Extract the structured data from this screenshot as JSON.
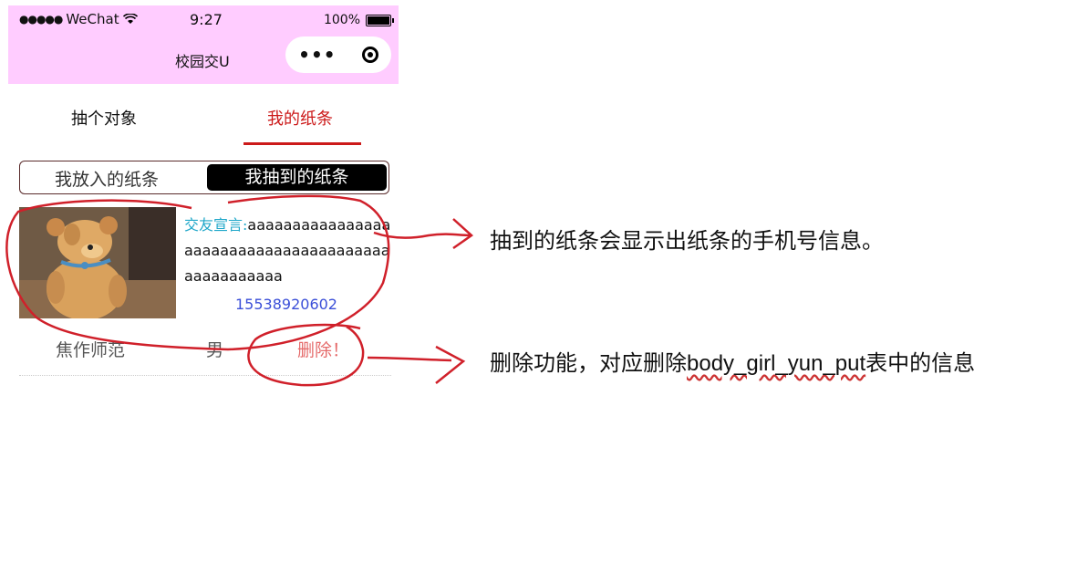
{
  "status_bar": {
    "carrier": "WeChat",
    "time": "9:27",
    "battery": "100%"
  },
  "nav": {
    "title": "校园交U",
    "more_icon": "more-dots-icon",
    "close_icon": "target-circle-icon"
  },
  "tabs": [
    {
      "label": "抽个对象"
    },
    {
      "label": "我的纸条"
    }
  ],
  "segment": {
    "option_a": "我放入的纸条",
    "option_b": "我抽到的纸条"
  },
  "card": {
    "declaration_label": "交友宣言:",
    "declaration_text": "aaaaaaaaaaaaaaaaaaaaaaaaaaaaaaaaaaaaaaaaaaaaaaaaaa",
    "phone": "15538920602",
    "location": "焦作师范",
    "gender": "男",
    "delete_label": "删除！"
  },
  "annotations": {
    "note1": "抽到的纸条会显示出纸条的手机号信息。",
    "note2_prefix": "删除功能，对应删除",
    "note2_table": "body_girl_yun_put",
    "note2_suffix": "表中的信息"
  },
  "colors": {
    "status_bg": "#ffccff",
    "accent_red": "#cc1a1a",
    "annotation_red": "#d0202a",
    "phone_blue": "#3b4fd8",
    "label_cyan": "#1fa7c9"
  }
}
